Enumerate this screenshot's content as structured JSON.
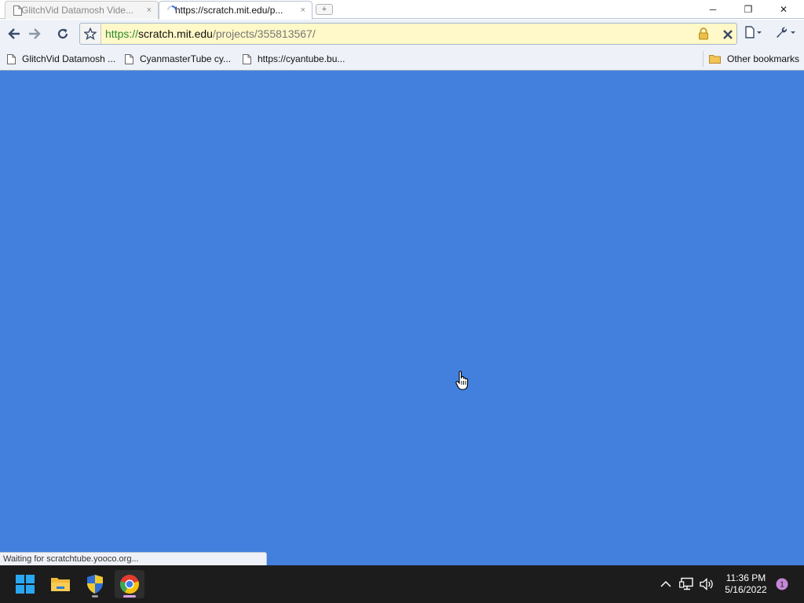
{
  "tabs": [
    {
      "title": "GlitchVid Datamosh Vide...",
      "close": "×",
      "state": "inactive"
    },
    {
      "title": "https://scratch.mit.edu/p...",
      "close": "×",
      "state": "active-loading"
    }
  ],
  "new_tab_glyph": "+",
  "window_controls": {
    "minimize": "─",
    "maximize": "❐",
    "close": "✕"
  },
  "omnibox": {
    "scheme": "https://",
    "host": "scratch.mit.edu",
    "path": "/projects/355813567/",
    "background_color": "#fff8c8"
  },
  "bookmarks": [
    {
      "label": "GlitchVid Datamosh ..."
    },
    {
      "label": "CyanmasterTube cy..."
    },
    {
      "label": "https://cyantube.bu..."
    }
  ],
  "other_bookmarks": "Other bookmarks",
  "page": {
    "background_color": "#4380dd"
  },
  "status_bar": "Waiting for scratchtube.yooco.org...",
  "clock": {
    "time": "11:36 PM",
    "date": "5/16/2022"
  },
  "notification_count": "1",
  "icons": {
    "back": "arrow-left-icon",
    "forward": "arrow-right-icon",
    "reload": "reload-icon",
    "star": "star-icon",
    "lock": "lock-icon",
    "stop": "stop-icon",
    "page_menu": "page-icon",
    "wrench_menu": "wrench-icon",
    "folder": "folder-icon",
    "start": "windows-start-icon",
    "explorer": "file-explorer-icon",
    "security": "security-shield-icon",
    "chrome": "chrome-icon"
  }
}
